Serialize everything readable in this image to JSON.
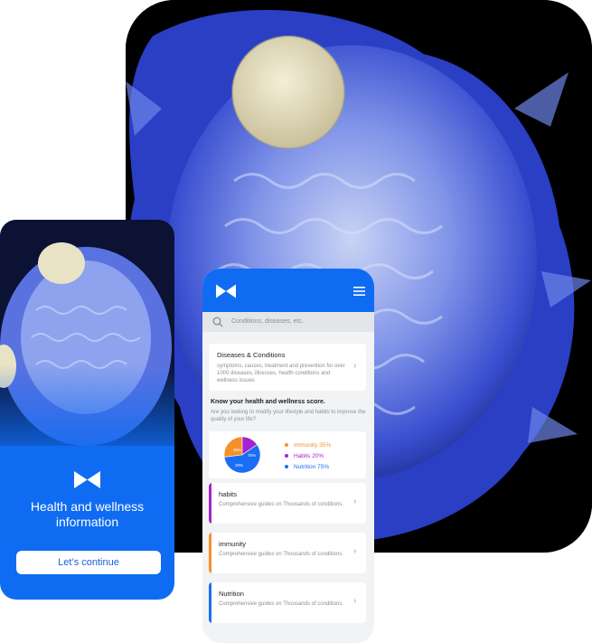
{
  "colors": {
    "brand_blue": "#0f6cf2",
    "immunity": "#f5902a",
    "habits": "#a224d0",
    "nutrition": "#1a6ef5"
  },
  "left_phone": {
    "logo_icon": "m-logo-icon",
    "title": "Health and wellness information",
    "continue_label": "Let’s continue"
  },
  "right_phone": {
    "header": {
      "logo_icon": "m-logo-icon",
      "menu_icon": "hamburger-icon"
    },
    "search": {
      "placeholder": "Conditions, diseases, etc.",
      "icon": "search-icon"
    },
    "diseases_card": {
      "title": "Diseases & Conditions",
      "description": "symptoms, causes, treatment and prevention for over 1000 diseases, illnesses, health conditions and wellness issues"
    },
    "score": {
      "title": "Know your health and wellness score.",
      "description": "Are you looking to modify your lifestyle and habits to improve the quality of your life?",
      "legend": [
        {
          "label": "Immunity 35%",
          "color": "#f5902a"
        },
        {
          "label": "Habits 20%",
          "color": "#a224d0"
        },
        {
          "label": "Nutrition 75%",
          "color": "#1a6ef5"
        }
      ],
      "pie_labels": [
        "35%",
        "20%",
        "75%"
      ]
    },
    "topics": [
      {
        "title": "habits",
        "description": "Comprehensive guides on Thousands  of conditions.",
        "color": "#a224d0"
      },
      {
        "title": "immunity",
        "description": "Comprehensive guides on Thousands  of conditions.",
        "color": "#f5902a"
      },
      {
        "title": "Nutrition",
        "description": "Comprehensive guides on Thousands  of conditions.",
        "color": "#1a6ef5"
      }
    ]
  }
}
